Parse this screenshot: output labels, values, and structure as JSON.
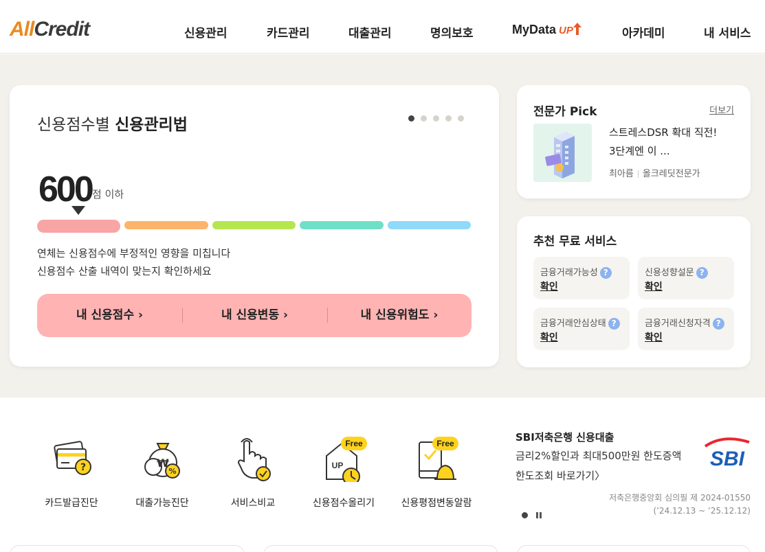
{
  "header": {
    "logo_part1": "All",
    "logo_part2": "Credit",
    "nav": [
      "신용관리",
      "카드관리",
      "대출관리",
      "명의보호",
      "MyData",
      "아카데미",
      "내 서비스"
    ],
    "mydata_badge": "UP"
  },
  "main_card": {
    "title_normal": "신용점수별",
    "title_bold": "신용관리법",
    "slide_total": 5,
    "slide_active": 1,
    "score_value": "600",
    "score_unit": "점 이하",
    "desc_line1": "연체는 신용점수에 부정적인 영향을 미칩니다",
    "desc_line2": "신용점수 산출 내역이 맞는지 확인하세요",
    "buttons": [
      "내 신용점수 ›",
      "내 신용변동 ›",
      "내 신용위험도 ›"
    ],
    "score_bar_colors": [
      "#f7a5a5",
      "#fdb46a",
      "#b5e650",
      "#6fe0c7",
      "#8fd9fb"
    ]
  },
  "expert": {
    "title": "전문가 Pick",
    "more": "더보기",
    "article_line1": "스트레스DSR 확대 직전!",
    "article_line2": "3단계엔 이 ...",
    "author_name": "최아름",
    "author_role": "올크레딧전문가"
  },
  "free_services": {
    "title": "추천 무료 서비스",
    "items": [
      {
        "label": "금융거래가능성",
        "action": "확인"
      },
      {
        "label": "신용성향설문",
        "action": "확인"
      },
      {
        "label": "금융거래안심상태",
        "action": "확인"
      },
      {
        "label": "금융거래신청자격",
        "action": "확인"
      }
    ],
    "help_symbol": "?"
  },
  "quick_menu": {
    "items": [
      {
        "label": "카드발급진단",
        "icon": "card-check-icon"
      },
      {
        "label": "대출가능진단",
        "icon": "money-bag-icon"
      },
      {
        "label": "서비스비교",
        "icon": "hand-pointer-icon"
      },
      {
        "label": "신용점수올리기",
        "icon": "house-up-icon",
        "tag": "Free"
      },
      {
        "label": "신용평점변동알람",
        "icon": "phone-alarm-icon",
        "tag": "Free"
      }
    ]
  },
  "sbi_banner": {
    "title": "SBI저축은행 신용대출",
    "line1": "금리2%할인과 최대500만원 한도증액",
    "line2": "한도조회 바로가기〉",
    "logo_text": "SBI",
    "note1": "저축은행중앙회 심의필 제 2024-01550",
    "note2": "(’24.12.13 ~ ’25.12.12)"
  }
}
